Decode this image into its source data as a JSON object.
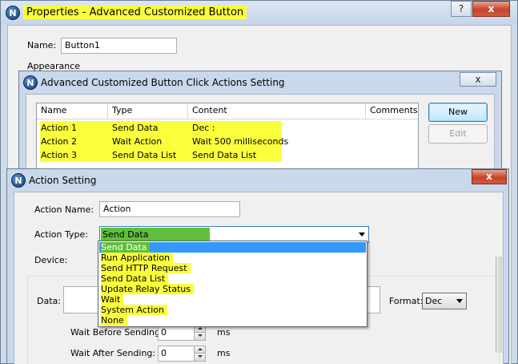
{
  "properties_window": {
    "title": "Properties - Advanced Customized Button",
    "help_glyph": "?",
    "close_glyph": "x",
    "name_label": "Name:",
    "name_value": "Button1",
    "appearance_label": "Appearance"
  },
  "click_actions_window": {
    "title": "Advanced Customized Button Click Actions Setting",
    "close_glyph": "x",
    "columns": [
      "Name",
      "Type",
      "Content",
      "Comments"
    ],
    "rows": [
      {
        "name": "Action 1",
        "type": "Send Data",
        "content": "Dec :",
        "comments": ""
      },
      {
        "name": "Action 2",
        "type": "Wait Action",
        "content": "Wait 500 milliseconds",
        "comments": ""
      },
      {
        "name": "Action 3",
        "type": "Send Data List",
        "content": "Send Data List",
        "comments": ""
      }
    ],
    "new_button": "New",
    "edit_button": "Edit"
  },
  "action_setting_window": {
    "title": "Action Setting",
    "close_glyph": "x",
    "action_name_label": "Action Name:",
    "action_name_value": "Action",
    "action_type_label": "Action Type:",
    "action_type_value": "Send Data",
    "device_label": "Device:",
    "data_label": "Data:",
    "format_label": "Format:",
    "format_value": "Dec",
    "wait_before_label": "Wait Before Sending:",
    "wait_before_value": "0",
    "wait_before_unit": "ms",
    "wait_after_label": "Wait After Sending:",
    "wait_after_value": "0",
    "wait_after_unit": "ms"
  },
  "action_type_options": [
    "Send Data",
    "Run Application",
    "Send HTTP Request",
    "Send Data List",
    "Update Relay Status",
    "Wait",
    "System Action",
    "None"
  ],
  "selected_option_index": 0,
  "colors": {
    "highlight_yellow": "#fbff3b",
    "selection_blue": "#3399ff",
    "close_red": "#c8432b"
  },
  "icons": {
    "app_logo": "N"
  }
}
